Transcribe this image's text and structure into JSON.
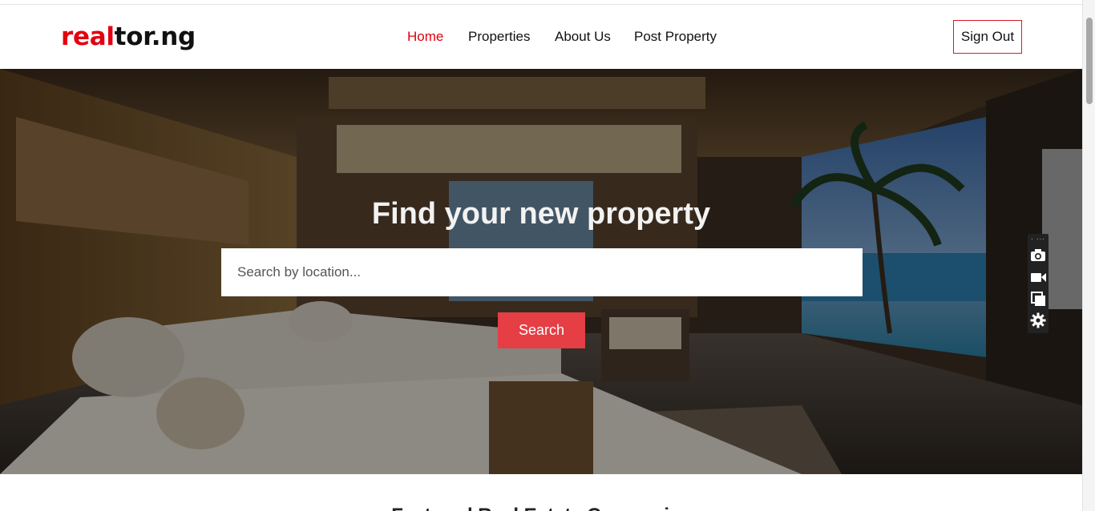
{
  "brand": {
    "logo_part1": "real",
    "logo_part2": "tor.ng",
    "accent_color": "#e3000f"
  },
  "nav": {
    "items": [
      {
        "label": "Home",
        "active": true
      },
      {
        "label": "Properties",
        "active": false
      },
      {
        "label": "About Us",
        "active": false
      },
      {
        "label": "Post Property",
        "active": false
      }
    ],
    "sign_out_label": "Sign Out"
  },
  "hero": {
    "title": "Find your new property",
    "search_placeholder": "Search by location...",
    "search_button_label": "Search",
    "search_button_color": "#e53e45"
  },
  "section": {
    "heading": "Featured Real Estate Companies"
  },
  "tool_panel": {
    "icons": [
      "camera-icon",
      "video-icon",
      "copy-icon",
      "settings-icon"
    ]
  }
}
